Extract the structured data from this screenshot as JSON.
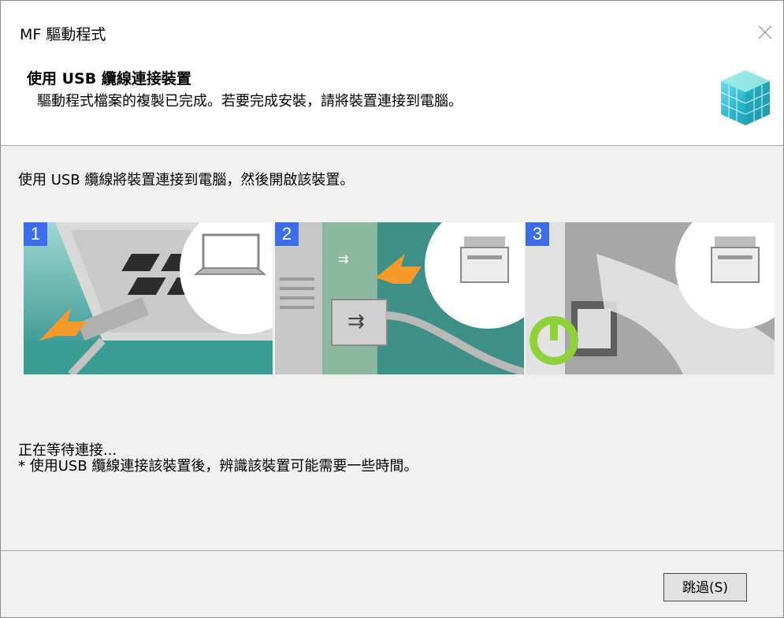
{
  "window": {
    "title": "MF 驅動程式",
    "close_icon": "close-icon"
  },
  "header": {
    "title": "使用 USB 纜線連接裝置",
    "subtitle": "驅動程式檔案的複製已完成。若要完成安裝，請將裝置連接到電腦。",
    "logo_icon": "cube-logo-icon"
  },
  "main": {
    "instruction": "使用 USB 纜線將裝置連接到電腦，然後開啟該裝置。",
    "steps": [
      {
        "number": "1",
        "icon": "laptop-usb-illustration"
      },
      {
        "number": "2",
        "icon": "printer-usb-port-illustration"
      },
      {
        "number": "3",
        "icon": "printer-power-on-illustration"
      }
    ],
    "waiting_text": "正在等待連接...",
    "note_text": "* 使用USB 纜線連接該裝置後，辨識該裝置可能需要一些時間。"
  },
  "footer": {
    "skip_label": "跳過(S)"
  },
  "colors": {
    "step_badge": "#3d6ee8",
    "teal": "#2e9e9a",
    "power_green": "#8fd13b",
    "arrow_orange": "#f39a2b"
  }
}
